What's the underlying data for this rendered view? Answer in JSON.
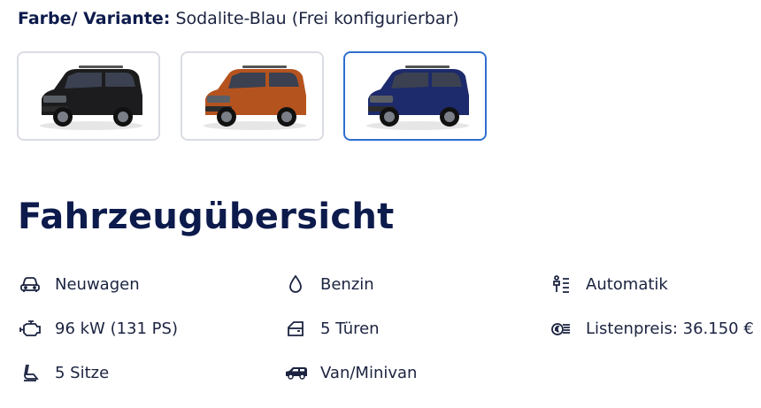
{
  "variant": {
    "label": "Farbe/ Variante:",
    "value": "Sodalite-Blau (Frei konfigurierbar)"
  },
  "color_options": [
    {
      "name": "black",
      "body_color": "#1c1c1e",
      "selected": false
    },
    {
      "name": "orange",
      "body_color": "#b5531f",
      "selected": false
    },
    {
      "name": "blue",
      "body_color": "#1d2a6b",
      "selected": true
    }
  ],
  "overview": {
    "title": "Fahrzeugübersicht",
    "specs": [
      {
        "icon": "car-front-icon",
        "text": "Neuwagen"
      },
      {
        "icon": "fuel-drop-icon",
        "text": "Benzin"
      },
      {
        "icon": "gearbox-icon",
        "text": "Automatik"
      },
      {
        "icon": "engine-icon",
        "text": "96 kW (131 PS)"
      },
      {
        "icon": "door-icon",
        "text": "5 Türen"
      },
      {
        "icon": "price-tag-icon",
        "text": "Listenpreis: 36.150 €"
      },
      {
        "icon": "seat-icon",
        "text": "5 Sitze"
      },
      {
        "icon": "van-icon",
        "text": "Van/Minivan"
      }
    ]
  }
}
